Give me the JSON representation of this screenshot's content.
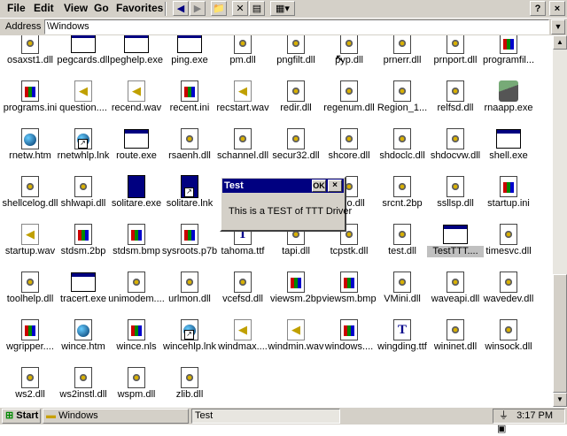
{
  "menubar": {
    "menus": [
      "File",
      "Edit",
      "View",
      "Go",
      "Favorites"
    ],
    "help_label": "?",
    "close_label": "×"
  },
  "address": {
    "label": "Address",
    "value": "\\Windows"
  },
  "items": [
    {
      "label": "osaxst1.dll",
      "type": "dll"
    },
    {
      "label": "pegcards.dll",
      "type": "exe"
    },
    {
      "label": "peghelp.exe",
      "type": "exe"
    },
    {
      "label": "ping.exe",
      "type": "exe"
    },
    {
      "label": "pm.dll",
      "type": "dll"
    },
    {
      "label": "pngfilt.dll",
      "type": "dll"
    },
    {
      "label": "pyp.dll",
      "type": "dll"
    },
    {
      "label": "prnerr.dll",
      "type": "dll"
    },
    {
      "label": "prnport.dll",
      "type": "dll"
    },
    {
      "label": "programfil...",
      "type": "ini"
    },
    {
      "label": "programs.ini",
      "type": "ini"
    },
    {
      "label": "question....",
      "type": "wav"
    },
    {
      "label": "recend.wav",
      "type": "wav"
    },
    {
      "label": "recent.ini",
      "type": "ini"
    },
    {
      "label": "recstart.wav",
      "type": "wav"
    },
    {
      "label": "redir.dll",
      "type": "dll"
    },
    {
      "label": "regenum.dll",
      "type": "dll"
    },
    {
      "label": "Region_1...",
      "type": "dll"
    },
    {
      "label": "relfsd.dll",
      "type": "dll"
    },
    {
      "label": "rnaapp.exe",
      "type": "phone"
    },
    {
      "label": "rnetw.htm",
      "type": "htm"
    },
    {
      "label": "rnetwhlp.lnk",
      "type": "htm-lnk"
    },
    {
      "label": "route.exe",
      "type": "exe"
    },
    {
      "label": "rsaenh.dll",
      "type": "dll"
    },
    {
      "label": "schannel.dll",
      "type": "dll"
    },
    {
      "label": "secur32.dll",
      "type": "dll"
    },
    {
      "label": "shcore.dll",
      "type": "dll"
    },
    {
      "label": "shdoclc.dll",
      "type": "dll"
    },
    {
      "label": "shdocvw.dll",
      "type": "dll"
    },
    {
      "label": "shell.exe",
      "type": "exe"
    },
    {
      "label": "shellcelog.dll",
      "type": "dll"
    },
    {
      "label": "shlwapi.dll",
      "type": "dll"
    },
    {
      "label": "solitare.exe",
      "type": "sol"
    },
    {
      "label": "solitare.lnk",
      "type": "sol-lnk"
    },
    {
      "label": "",
      "type": "hidden"
    },
    {
      "label": "",
      "type": "hidden"
    },
    {
      "label": "...go.dll",
      "type": "dll"
    },
    {
      "label": "srcnt.2bp",
      "type": "dll"
    },
    {
      "label": "ssllsp.dll",
      "type": "dll"
    },
    {
      "label": "startup.ini",
      "type": "ini"
    },
    {
      "label": "startup.wav",
      "type": "wav"
    },
    {
      "label": "stdsm.2bp",
      "type": "ini"
    },
    {
      "label": "stdsm.bmp",
      "type": "ini"
    },
    {
      "label": "sysroots.p7b",
      "type": "ini"
    },
    {
      "label": "tahoma.ttf",
      "type": "ttf"
    },
    {
      "label": "tapi.dll",
      "type": "dll"
    },
    {
      "label": "tcpstk.dll",
      "type": "dll"
    },
    {
      "label": "test.dll",
      "type": "dll"
    },
    {
      "label": "TestTTT....",
      "type": "exe"
    },
    {
      "label": "timesvc.dll",
      "type": "dll"
    },
    {
      "label": "toolhelp.dll",
      "type": "dll"
    },
    {
      "label": "tracert.exe",
      "type": "exe"
    },
    {
      "label": "unimodem....",
      "type": "dll"
    },
    {
      "label": "urlmon.dll",
      "type": "dll"
    },
    {
      "label": "vcefsd.dll",
      "type": "dll"
    },
    {
      "label": "viewsm.2bp",
      "type": "ini"
    },
    {
      "label": "viewsm.bmp",
      "type": "ini"
    },
    {
      "label": "VMini.dll",
      "type": "dll"
    },
    {
      "label": "waveapi.dll",
      "type": "dll"
    },
    {
      "label": "wavedev.dll",
      "type": "dll"
    },
    {
      "label": "wgripper....",
      "type": "ini"
    },
    {
      "label": "wince.htm",
      "type": "htm"
    },
    {
      "label": "wince.nls",
      "type": "ini"
    },
    {
      "label": "wincehlp.lnk",
      "type": "htm-lnk"
    },
    {
      "label": "windmax....",
      "type": "wav"
    },
    {
      "label": "windmin.wav",
      "type": "wav"
    },
    {
      "label": "windows....",
      "type": "ini"
    },
    {
      "label": "wingding.ttf",
      "type": "ttf"
    },
    {
      "label": "wininet.dll",
      "type": "dll"
    },
    {
      "label": "winsock.dll",
      "type": "dll"
    },
    {
      "label": "ws2.dll",
      "type": "dll"
    },
    {
      "label": "ws2instl.dll",
      "type": "dll"
    },
    {
      "label": "wspm.dll",
      "type": "dll"
    },
    {
      "label": "zlib.dll",
      "type": "dll"
    }
  ],
  "selected_item": "TestTTT....",
  "dialog": {
    "title": "Test",
    "ok_label": "OK",
    "close_label": "×",
    "message": "This is a TEST of TTT Driver"
  },
  "taskbar": {
    "start_label": "Start",
    "window_button": "Windows",
    "active_button": "Test",
    "clock": "3:17 PM"
  },
  "colors": {
    "title_bar": "#000080",
    "chrome": "#d4d0c8",
    "background": "#ffffff"
  }
}
